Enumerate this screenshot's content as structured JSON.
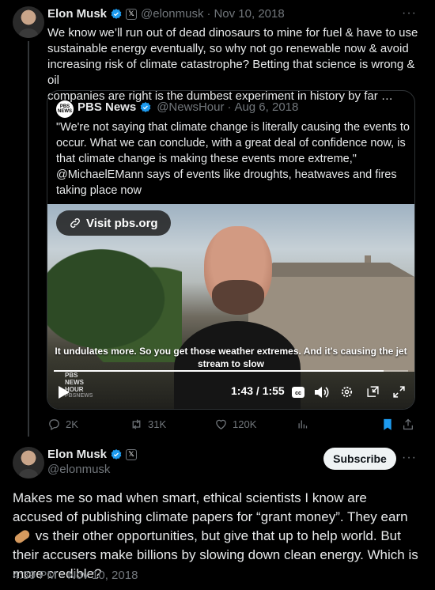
{
  "first_tweet": {
    "author_name": "Elon Musk",
    "handle": "@elonmusk",
    "separator": "·",
    "date": "Nov 10, 2018",
    "more": "···",
    "text_lines": [
      "We know we’ll run out of dead dinosaurs to mine for fuel & have to use",
      "sustainable energy eventually, so why not go renewable now & avoid",
      "increasing risk of climate catastrophe? Betting that science is wrong & oil",
      "companies are right is the dumbest experiment in history by far …"
    ]
  },
  "quote_tweet": {
    "logo_text": "PBS NEWS",
    "author_name": "PBS News",
    "handle": "@NewsHour",
    "separator": "·",
    "date": "Aug 6, 2018",
    "text_lines": [
      "\"We're not saying that climate change is literally causing the events to",
      "occur. What we can conclude, with a great deal of confidence now, is",
      "that climate change is making these events more extreme,\"",
      "@MichaelEMann says of events like droughts, heatwaves and fires",
      "taking place now"
    ],
    "video": {
      "visit_label": "Visit pbs.org",
      "caption_line1": "It undulates more. So you get those weather extremes. And it's causing the jet",
      "caption_line2": "stream to slow",
      "watermark": "PBS NEWS HOUR",
      "watermark_small": "PBSNEWS",
      "time": "1:43 / 1:55",
      "progress": 0.93
    }
  },
  "actions": {
    "replies": "2K",
    "retweets": "31K",
    "likes": "120K"
  },
  "second_tweet": {
    "author_name": "Elon Musk",
    "handle": "@elonmusk",
    "subscribe_label": "Subscribe",
    "more": "···",
    "text_before_emoji": "Makes me so mad when smart, ethical scientists I know are accused of publishing climate papers for “grant money”. They earn",
    "text_after_emoji": "vs their other opportunities, but give that up to help world. But their accusers make billions by slowing down clean energy. Which is more credible?",
    "timestamp": "4:39 PM · Nov 10, 2018"
  },
  "colors": {
    "background": "#000000",
    "text": "#e7e9ea",
    "muted": "#71767b",
    "verified": "#1d9bf0",
    "border": "#2f3336",
    "bookmark": "#1d9bf0"
  },
  "icons": [
    "verified-badge-icon",
    "x-affiliate-icon",
    "more-icon",
    "link-icon",
    "play-icon",
    "captions-icon",
    "volume-icon",
    "settings-icon",
    "pip-icon",
    "fullscreen-icon",
    "reply-icon",
    "retweet-icon",
    "like-icon",
    "views-icon",
    "bookmark-icon",
    "share-icon",
    "peanut-emoji"
  ]
}
